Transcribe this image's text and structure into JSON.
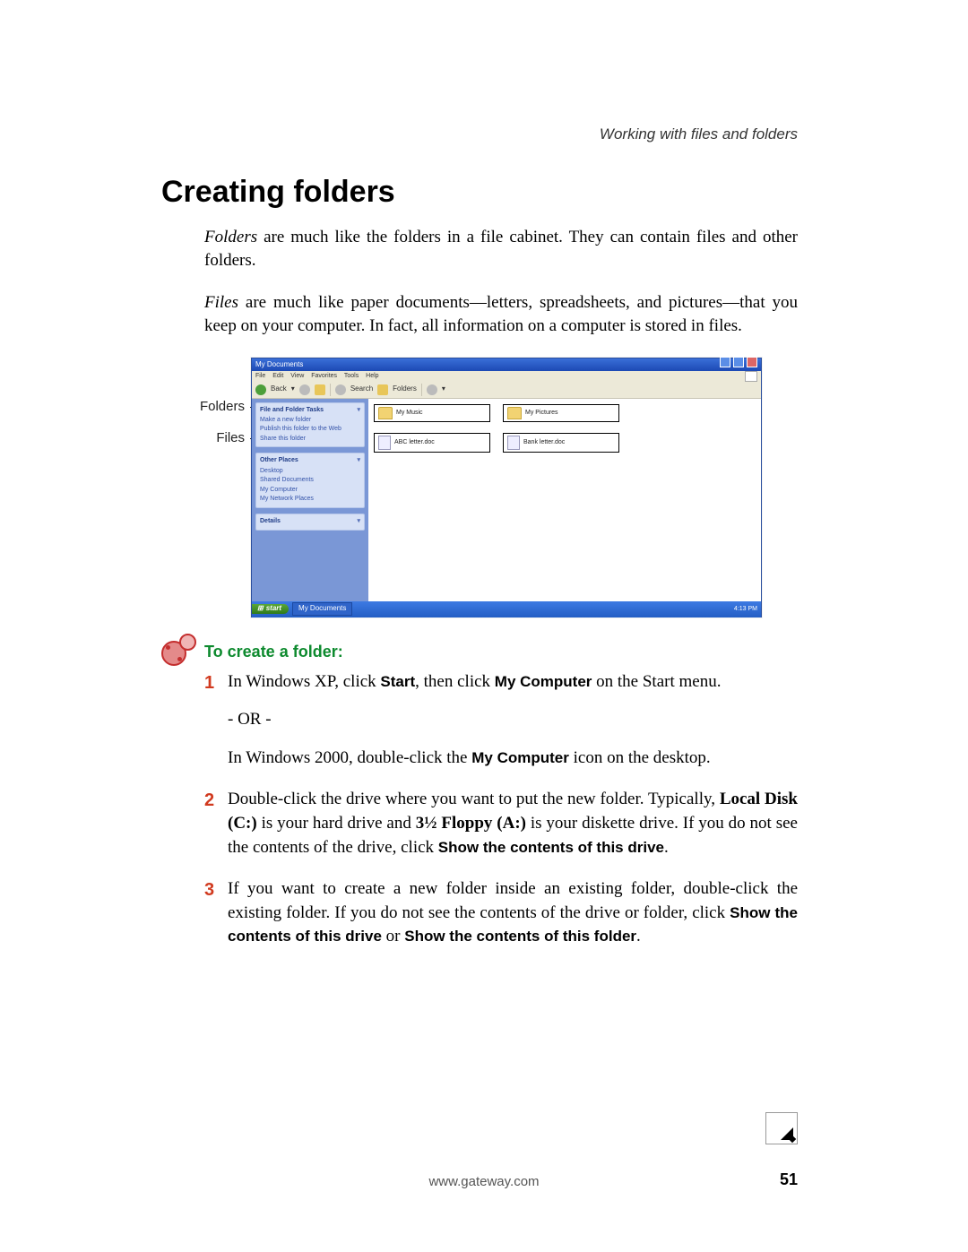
{
  "header": {
    "running": "Working with files and folders"
  },
  "title": "Creating folders",
  "intro": {
    "folders_term": "Folders",
    "folders_text": " are much like the folders in a file cabinet. They can contain files and other folders.",
    "files_term": "Files",
    "files_text": " are much like paper documents—letters, spreadsheets, and pictures—that you keep on your computer. In fact, all information on a computer is stored in files."
  },
  "callouts": {
    "folders": "Folders",
    "files": "Files"
  },
  "screenshot": {
    "title": "My Documents",
    "menus": [
      "File",
      "Edit",
      "View",
      "Favorites",
      "Tools",
      "Help"
    ],
    "toolbar": {
      "back": "Back",
      "search": "Search",
      "folders": "Folders"
    },
    "side": {
      "tasks": {
        "header": "File and Folder Tasks",
        "items": [
          "Make a new folder",
          "Publish this folder to the Web",
          "Share this folder"
        ]
      },
      "places": {
        "header": "Other Places",
        "items": [
          "Desktop",
          "Shared Documents",
          "My Computer",
          "My Network Places"
        ]
      },
      "details": {
        "header": "Details"
      }
    },
    "items": {
      "folder1": "My Music",
      "folder2": "My Pictures",
      "file1": "ABC letter.doc",
      "file2": "Bank letter.doc"
    },
    "taskbar": {
      "start": "start",
      "button": "My Documents",
      "clock": "4:13 PM"
    }
  },
  "procedure": {
    "title": "To create a folder:",
    "steps": {
      "s1a": "In Windows XP, click ",
      "s1b": ", then click ",
      "s1c": " on the Start menu.",
      "s1_start": "Start",
      "s1_mycomp": "My Computer",
      "or": "- OR -",
      "s1d": "In Windows 2000, double-click the ",
      "s1e": " icon on the desktop.",
      "s2a": "Double-click the drive where you want to put the new folder. Typically, ",
      "s2_local": "Local Disk (C:)",
      "s2b": " is your hard drive and ",
      "s2_floppy": "3½ Floppy (A:)",
      "s2c": " is your diskette drive. If you do not see the contents of the drive, click ",
      "s2_show": "Show the contents of this drive",
      "s2d": ".",
      "s3a": "If you want to create a new folder inside an existing folder, double-click the existing folder. If you do not see the contents of the drive or folder, click ",
      "s3_show1": "Show the contents of this drive",
      "s3b": " or ",
      "s3_show2": "Show the contents of this folder",
      "s3c": "."
    }
  },
  "footer": {
    "url": "www.gateway.com",
    "page": "51"
  }
}
